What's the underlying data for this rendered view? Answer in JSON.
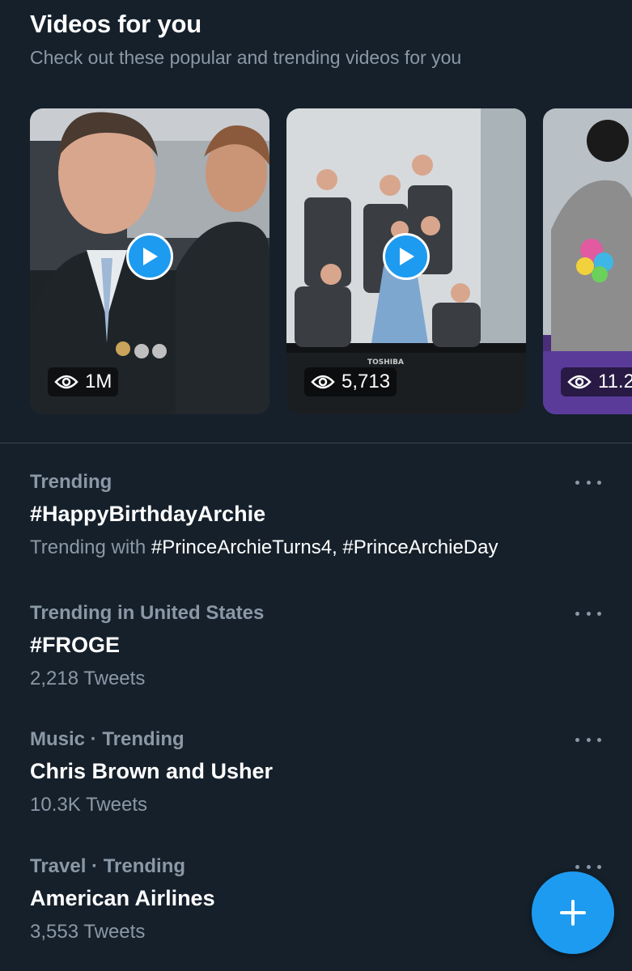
{
  "section": {
    "title": "Videos for you",
    "subtitle": "Check out these popular and trending videos for you"
  },
  "videos": [
    {
      "views": "1M"
    },
    {
      "views": "5,713"
    },
    {
      "views": "11.2"
    }
  ],
  "trends": [
    {
      "meta": "Trending",
      "name": "#HappyBirthdayArchie",
      "sub_prefix": "Trending with ",
      "sub_tags": "#PrinceArchieTurns4, #PrinceArchieDay"
    },
    {
      "meta": "Trending in United States",
      "name": "#FROGE",
      "sub": "2,218 Tweets"
    },
    {
      "meta": "Music · Trending",
      "name": "Chris Brown and Usher",
      "sub": "10.3K Tweets"
    },
    {
      "meta": "Travel · Trending",
      "name": "American Airlines",
      "sub": "3,553 Tweets"
    }
  ],
  "colors": {
    "background": "#15202b",
    "accent": "#1d9bf0",
    "secondary_text": "#8b98a5"
  },
  "icons": {
    "play": "play-icon",
    "views": "eye-icon",
    "more": "more-dots-icon",
    "compose": "plus-icon"
  }
}
